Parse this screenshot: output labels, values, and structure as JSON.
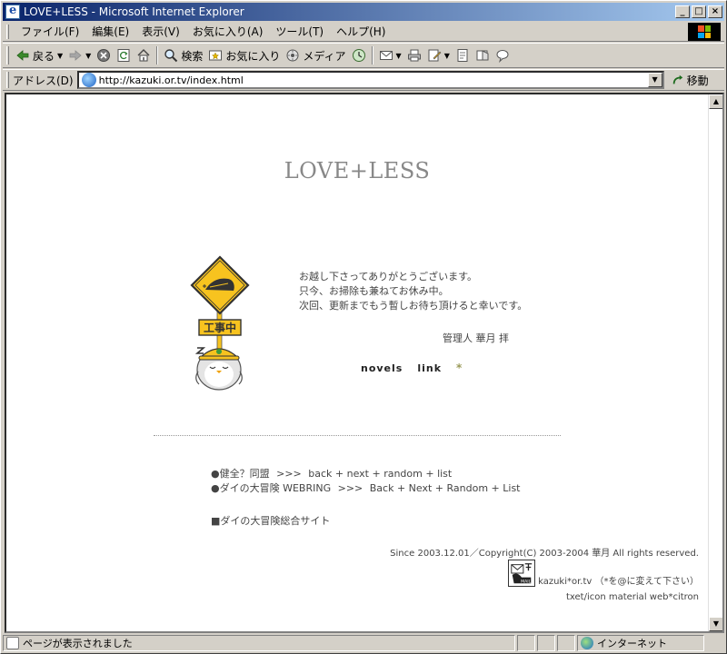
{
  "window": {
    "title": "LOVE+LESS - Microsoft Internet Explorer"
  },
  "window_controls": {
    "minimize": "_",
    "maximize": "□",
    "close": "×"
  },
  "menu": [
    "ファイル(F)",
    "編集(E)",
    "表示(V)",
    "お気に入り(A)",
    "ツール(T)",
    "ヘルプ(H)"
  ],
  "toolbar": {
    "back_label": "戻る",
    "search_label": "検索",
    "favorites_label": "お気に入り",
    "media_label": "メディア"
  },
  "address": {
    "label": "アドレス(D)",
    "url": "http://kazuki.or.tv/index.html",
    "go_label": "移動"
  },
  "page": {
    "title": "LOVE+LESS",
    "sign_text": "工事中",
    "message": [
      "お越し下さってありがとうございます。",
      "只今、お掃除も兼ねてお休み中。",
      "次回、更新までもう暫しお待ち頂けると幸いです。"
    ],
    "admin": "管理人  華月  拝",
    "nav": {
      "novels": "novels",
      "link": "link",
      "star": "*"
    },
    "rings": [
      {
        "name": "●健全？同盟",
        "arrow": ">>>",
        "links": "back + next + random + list"
      },
      {
        "name": "●ダイの大冒険 WEBRING",
        "arrow": ">>>",
        "links": "Back + Next + Random + List"
      }
    ],
    "dai_site": "■ダイの大冒険総合サイト",
    "copyright": "Since  2003.12.01／Copyright(C) 2003-2004 華月  All rights reserved.",
    "mail_icon_label": "MAIL",
    "mail_text": "kazuki*or.tv （*を@に変えて下さい）",
    "credit": "txet/icon material  web*citron"
  },
  "status": {
    "text": "ページが表示されました",
    "zone": "インターネット"
  },
  "colors": {
    "titlebar_start": "#0A246A",
    "titlebar_end": "#A6CAF0",
    "chrome": "#D4D0C8",
    "sign_yellow": "#F7C31F"
  }
}
